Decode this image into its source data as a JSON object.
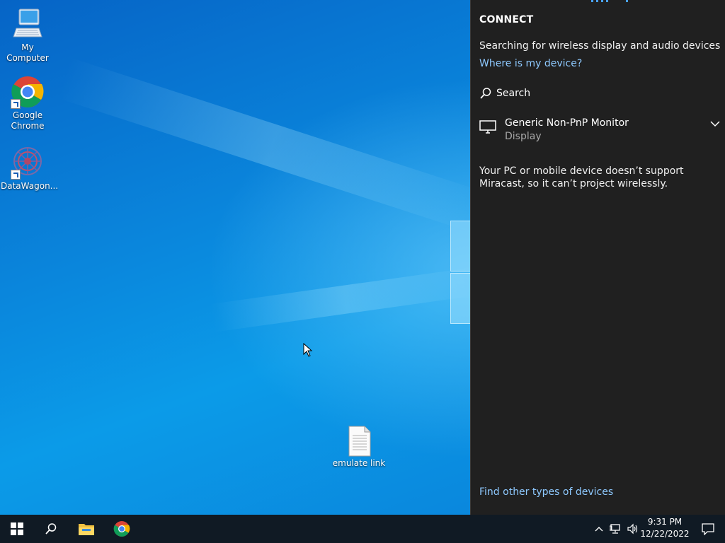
{
  "desktop": {
    "icons": [
      {
        "label": "My Computer",
        "icon": "computer-icon"
      },
      {
        "label": "Google Chrome",
        "icon": "chrome-icon"
      },
      {
        "label": "DataWagon...",
        "icon": "datawagon-icon"
      },
      {
        "label": "emulate link",
        "icon": "text-document-icon"
      }
    ]
  },
  "connect_panel": {
    "title": "CONNECT",
    "status": "Searching for wireless display and audio devices",
    "where_link": "Where is my device?",
    "search_label": "Search",
    "device": {
      "name": "Generic Non-PnP Monitor",
      "type": "Display"
    },
    "message": "Your PC or mobile device doesn’t support Miracast, so it can’t project wirelessly.",
    "other_link": "Find other types of devices"
  },
  "taskbar": {
    "clock_time": "9:31 PM",
    "clock_date": "12/22/2022",
    "buttons": [
      "windows-start-icon",
      "search-icon",
      "file-explorer-icon",
      "chrome-icon"
    ],
    "tray": [
      "chevron-up-icon",
      "network-icon",
      "volume-icon",
      "notification-icon"
    ]
  },
  "colors": {
    "panel_bg": "#202020",
    "link": "#8ec9ff",
    "taskbar_bg": "#101a24"
  }
}
